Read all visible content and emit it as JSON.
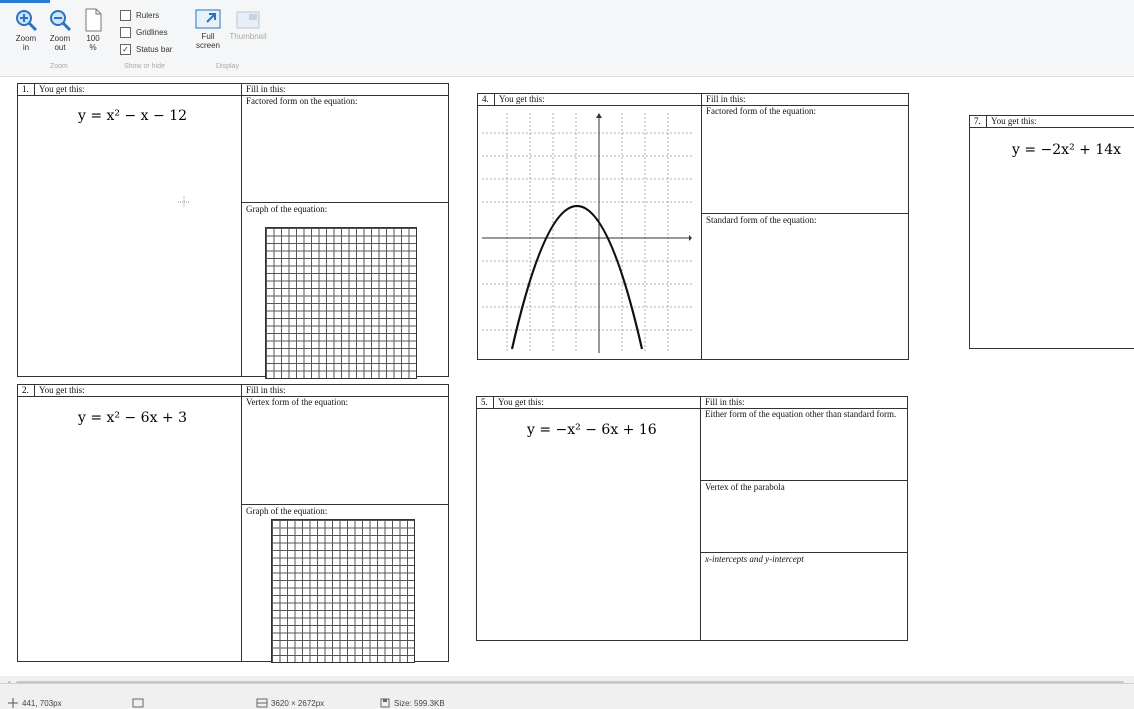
{
  "toolbar": {
    "zoom_in": "Zoom in",
    "zoom_out": "Zoom out",
    "actual_size": "100 %",
    "rulers": "Rulers",
    "gridlines": "Gridlines",
    "status_bar": "Status bar",
    "full_screen": "Full screen",
    "thumbnail": "Thumbnail",
    "group_zoom": "Zoom",
    "group_show": "Show or hide",
    "group_display": "Display"
  },
  "doc": {
    "p1": {
      "num": "1.",
      "you_get": "You get this:",
      "equation": "y = x² − x − 12",
      "fill": "Fill in this:",
      "q1": "Factored form on the equation:",
      "q2": "Graph of the equation:"
    },
    "p2": {
      "num": "2.",
      "you_get": "You get this:",
      "equation": "y = x² − 6x + 3",
      "fill": "Fill in this:",
      "q1": "Vertex form of the equation:",
      "q2": "Graph of the equation:"
    },
    "p4": {
      "num": "4.",
      "you_get": "You get this:",
      "fill": "Fill in this:",
      "q1": "Factored form of the equation:",
      "q2": "Standard form of the equation:"
    },
    "p5": {
      "num": "5.",
      "you_get": "You get this:",
      "equation": "y = −x² − 6x + 16",
      "fill": "Fill in this:",
      "q1": "Either form of the equation other than standard form.",
      "q2": "Vertex of the parabola",
      "q3": "x-intercepts and y-intercept"
    },
    "p7": {
      "num": "7.",
      "you_get": "You get this:",
      "equation": "y = −2x² + 14x"
    }
  },
  "status": {
    "cursor": "441, 703px",
    "dimensions": "3620 × 2672px",
    "size": "Size: 599.3KB"
  }
}
